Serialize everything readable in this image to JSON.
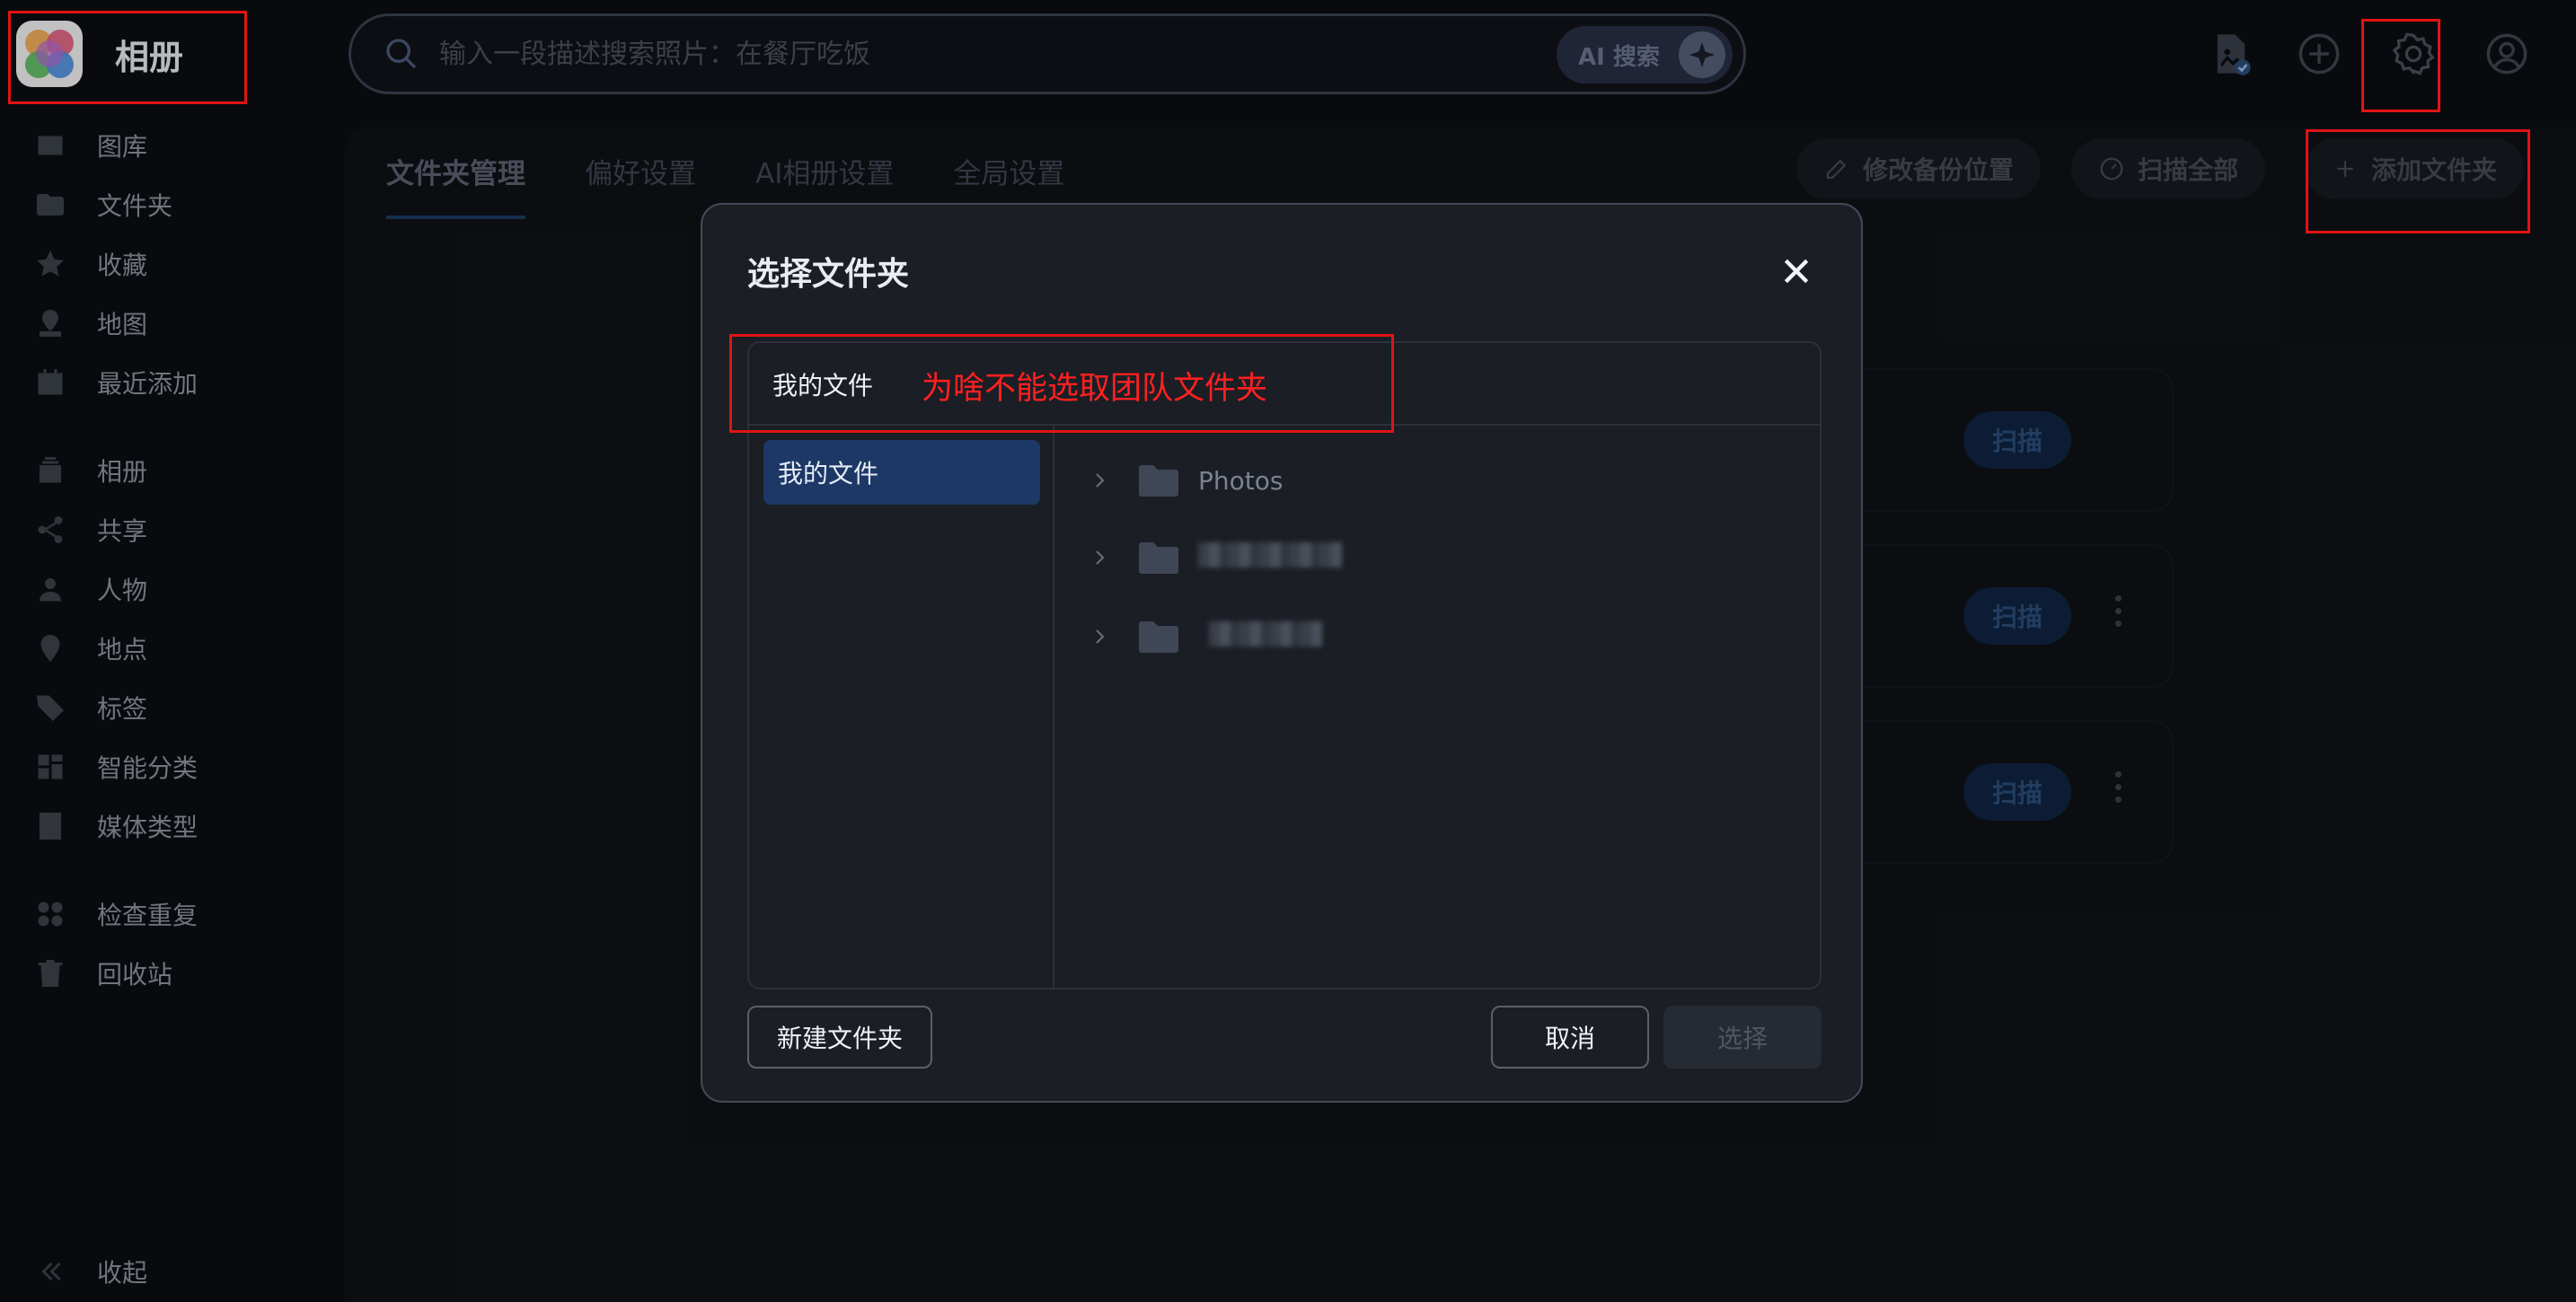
{
  "app": {
    "title": "相册"
  },
  "sidebar": {
    "items": [
      {
        "label": "图库",
        "icon": "gallery-icon"
      },
      {
        "label": "文件夹",
        "icon": "folder-icon"
      },
      {
        "label": "收藏",
        "icon": "star-icon"
      },
      {
        "label": "地图",
        "icon": "map-icon"
      },
      {
        "label": "最近添加",
        "icon": "calendar-icon"
      },
      {
        "label": "相册",
        "icon": "album-icon"
      },
      {
        "label": "共享",
        "icon": "share-icon"
      },
      {
        "label": "人物",
        "icon": "person-icon"
      },
      {
        "label": "地点",
        "icon": "location-icon"
      },
      {
        "label": "标签",
        "icon": "tag-icon"
      },
      {
        "label": "智能分类",
        "icon": "grid-icon"
      },
      {
        "label": "媒体类型",
        "icon": "film-icon"
      },
      {
        "label": "检查重复",
        "icon": "duplicate-icon"
      },
      {
        "label": "回收站",
        "icon": "trash-icon"
      }
    ],
    "collapse_label": "收起"
  },
  "search": {
    "placeholder": "输入一段描述搜索照片：在餐厅吃饭",
    "ai_label": "AI 搜索"
  },
  "tabs": [
    "文件夹管理",
    "偏好设置",
    "AI相册设置",
    "全局设置"
  ],
  "actions": {
    "edit_backup": "修改备份位置",
    "scan_all": "扫描全部",
    "add_folder": "添加文件夹"
  },
  "cards": {
    "scan_label": "扫描"
  },
  "dialog": {
    "title": "选择文件夹",
    "breadcrumb": "我的文件",
    "annotation": "为啥不能选取团队文件夹",
    "sources": [
      "我的文件"
    ],
    "folders": [
      {
        "name": "Photos"
      }
    ],
    "new_folder": "新建文件夹",
    "cancel": "取消",
    "select": "选择"
  },
  "colors": {
    "background": "#0b0d12",
    "dialog_bg": "#1b1e25",
    "selected_source": "#1d3867",
    "annotation_red": "#ff2020",
    "highlight_red": "#e01414"
  }
}
